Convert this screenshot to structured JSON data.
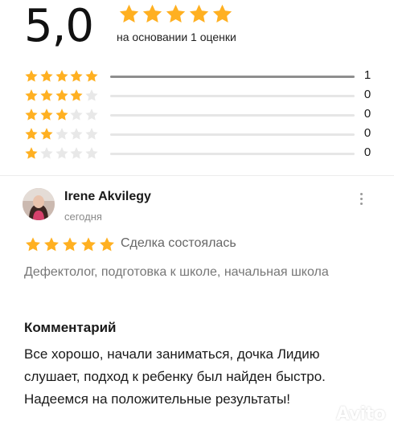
{
  "summary": {
    "rating": "5,0",
    "stars": 5,
    "caption": "на основании 1 оценки"
  },
  "histogram": [
    {
      "stars": 5,
      "count": "1",
      "share": 1.0
    },
    {
      "stars": 4,
      "count": "0",
      "share": 0
    },
    {
      "stars": 3,
      "count": "0",
      "share": 0
    },
    {
      "stars": 2,
      "count": "0",
      "share": 0
    },
    {
      "stars": 1,
      "count": "0",
      "share": 0
    }
  ],
  "review": {
    "author": "Irene Akvilegy",
    "date": "сегодня",
    "stars": 5,
    "status": "Сделка состоялась",
    "services": "Дефектолог, подготовка к школе, начальная школа",
    "comment_heading": "Комментарий",
    "comment": "Все хорошо, начали заниматься, дочка Лидию слушает, подход к ребенку был найден быстро. Надеемся на положительные результаты!"
  },
  "watermark": {
    "text": "Avito"
  },
  "colors": {
    "star_filled": "#ffb021",
    "star_empty": "#e8e8e8",
    "bar_fill": "#8e8e8e",
    "bar_track": "#e6e6e6",
    "muted_text": "#8a8a8a"
  },
  "icons": {
    "star": "star-icon",
    "more": "more-vertical-icon",
    "avatar": "user-avatar"
  }
}
